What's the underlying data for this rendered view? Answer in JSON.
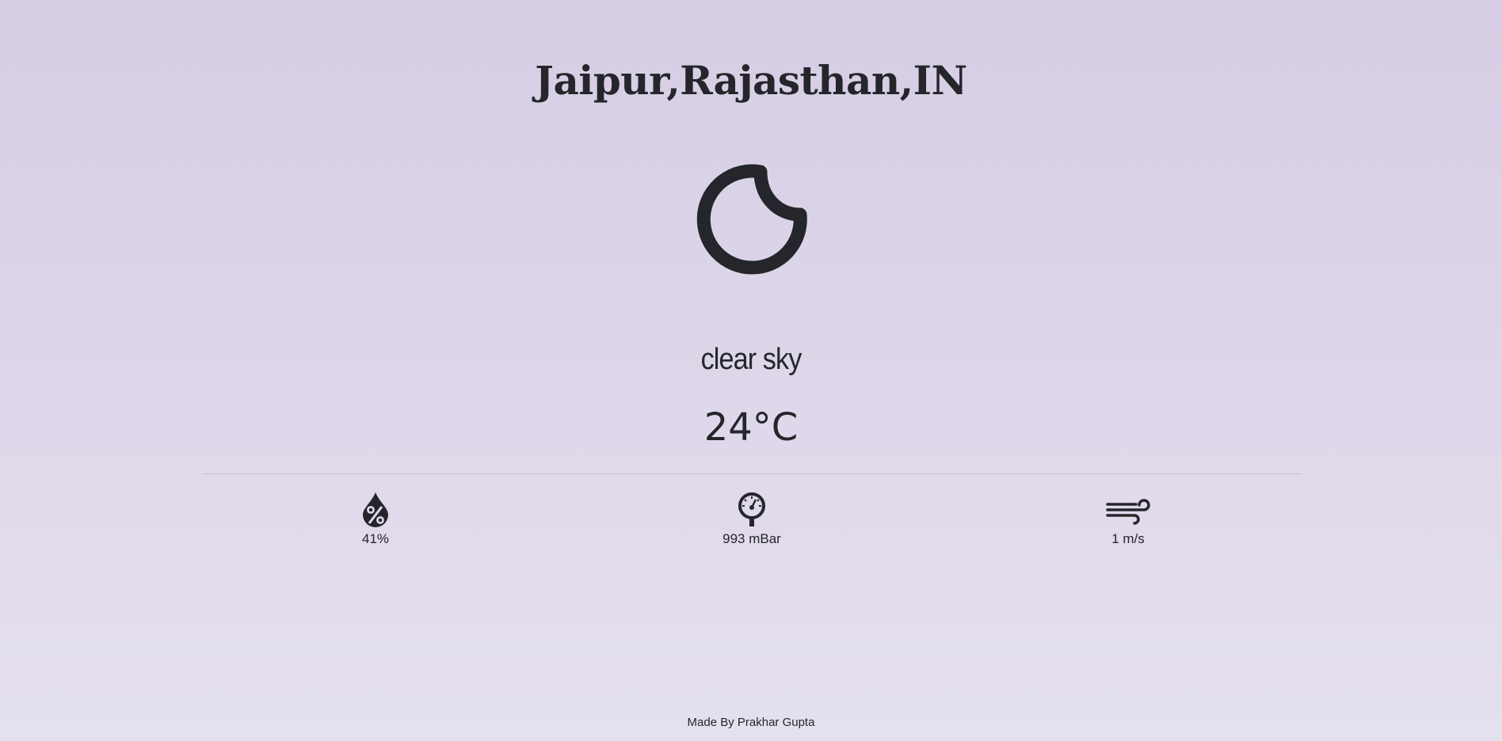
{
  "location": "Jaipur,Rajasthan,IN",
  "weather": {
    "icon": "moon-icon",
    "description": "clear sky",
    "temperature": "24°C"
  },
  "stats": {
    "humidity": {
      "icon": "humidity-icon",
      "value": "41%"
    },
    "pressure": {
      "icon": "pressure-gauge-icon",
      "value": "993 mBar"
    },
    "wind": {
      "icon": "wind-icon",
      "value": "1 m/s"
    }
  },
  "footer": "Made By Prakhar Gupta",
  "colors": {
    "text": "#25262b",
    "background_top": "#d6cde4",
    "background_bottom": "#e5e0ee"
  }
}
